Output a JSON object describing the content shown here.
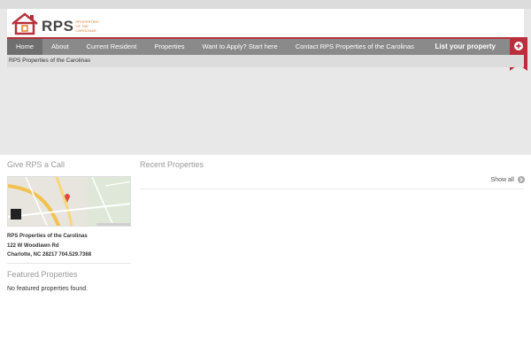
{
  "brand": {
    "logo_text": "RPS",
    "tagline": "Properties of the Carolinas",
    "accent_red": "#b8303b",
    "accent_orange": "#e07b2b"
  },
  "nav": {
    "items": [
      {
        "label": "Home"
      },
      {
        "label": "About"
      },
      {
        "label": "Current Resident"
      },
      {
        "label": "Properties"
      },
      {
        "label": "Want to Apply? Start here"
      },
      {
        "label": "Contact RPS Properties of the Carolinas"
      }
    ],
    "list_property": "List your property",
    "ribbon_icon": "plus-circle-icon"
  },
  "breadcrumb": {
    "text": "RPS Properties of the Carolinas"
  },
  "sidebar": {
    "call_title": "Give RPS a Call",
    "company": "RPS Properties of the Carolinas",
    "street": "122 W Woodlawn Rd",
    "city_phone": "Charlotte, NC 28217 704.529.7368",
    "featured_title": "Featured Properties",
    "featured_empty": "No featured properties found."
  },
  "main": {
    "recent_title": "Recent Properties",
    "show_all": "Show all",
    "show_all_icon": "chevron-right-circle-icon"
  }
}
